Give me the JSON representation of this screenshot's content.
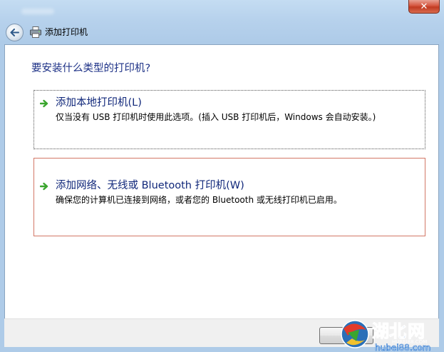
{
  "window": {
    "close_label": "✕"
  },
  "nav": {
    "title": "添加打印机"
  },
  "main": {
    "heading": "要安装什么类型的打印机?",
    "options": [
      {
        "title": "添加本地打印机(L)",
        "description": "仅当没有 USB 打印机时使用此选项。(插入 USB 打印机后，Windows 会自动安装。)"
      },
      {
        "title": "添加网络、无线或 Bluetooth 打印机(W)",
        "description": "确保您的计算机已连接到网络，或者您的 Bluetooth 或无线打印机已启用。"
      }
    ]
  },
  "watermark": {
    "brand": "湖北",
    "brand2": "网",
    "url": "hubei88.com",
    "url_small": "HUBEI88.COM"
  },
  "colors": {
    "heading": "#1e3287",
    "arrow": "#3aa52e",
    "selected_border": "#d27766"
  }
}
